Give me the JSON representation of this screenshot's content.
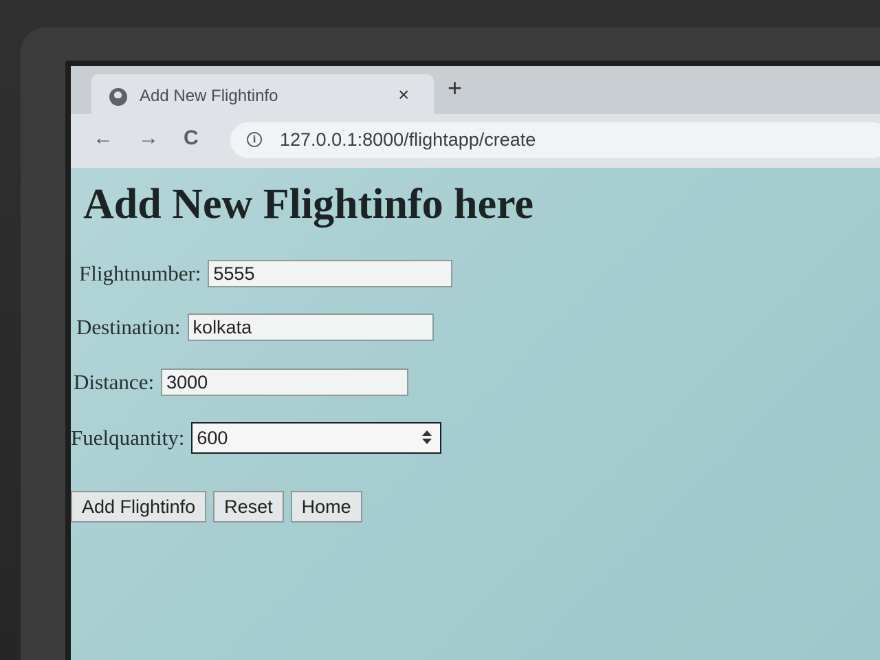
{
  "browser": {
    "tab_title": "Add New Flightinfo",
    "tab_close": "×",
    "new_tab": "+",
    "back_icon": "←",
    "forward_icon": "→",
    "reload_icon": "C",
    "info_icon": "i",
    "url": "127.0.0.1:8000/flightapp/create"
  },
  "page": {
    "title": "Add New Flightinfo here"
  },
  "form": {
    "flightnumber": {
      "label": "Flightnumber:",
      "value": "5555"
    },
    "destination": {
      "label": "Destination:",
      "value": "kolkata"
    },
    "distance": {
      "label": "Distance:",
      "value": "3000"
    },
    "fuelquantity": {
      "label": "Fuelquantity:",
      "value": "600"
    }
  },
  "buttons": {
    "add": "Add Flightinfo",
    "reset": "Reset",
    "home": "Home"
  }
}
